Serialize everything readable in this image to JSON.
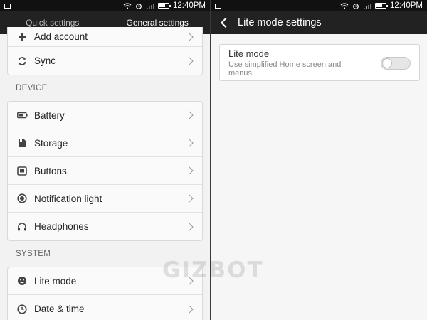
{
  "status_bar": {
    "time": "12:40PM"
  },
  "left": {
    "tabs": [
      {
        "label": "Quick settings",
        "active": false
      },
      {
        "label": "General settings",
        "active": true
      }
    ],
    "top_rows": [
      {
        "label": "Add account",
        "icon": "plus-icon"
      },
      {
        "label": "Sync",
        "icon": "sync-icon"
      }
    ],
    "device": {
      "header": "DEVICE",
      "rows": [
        {
          "label": "Battery",
          "icon": "battery-icon"
        },
        {
          "label": "Storage",
          "icon": "storage-icon"
        },
        {
          "label": "Buttons",
          "icon": "buttons-icon"
        },
        {
          "label": "Notification light",
          "icon": "notification-light-icon"
        },
        {
          "label": "Headphones",
          "icon": "headphones-icon"
        }
      ]
    },
    "system": {
      "header": "SYSTEM",
      "rows": [
        {
          "label": "Lite mode",
          "icon": "lite-mode-icon"
        },
        {
          "label": "Date & time",
          "icon": "clock-icon"
        }
      ]
    }
  },
  "right": {
    "title": "Lite mode settings",
    "lite_mode": {
      "title": "Lite mode",
      "description": "Use simplified Home screen and menus",
      "enabled": false
    }
  },
  "watermark": {
    "text": "GIZBOT"
  },
  "colors": {
    "bar": "#222222",
    "statusbar": "#111111",
    "background": "#f2f2f2"
  }
}
